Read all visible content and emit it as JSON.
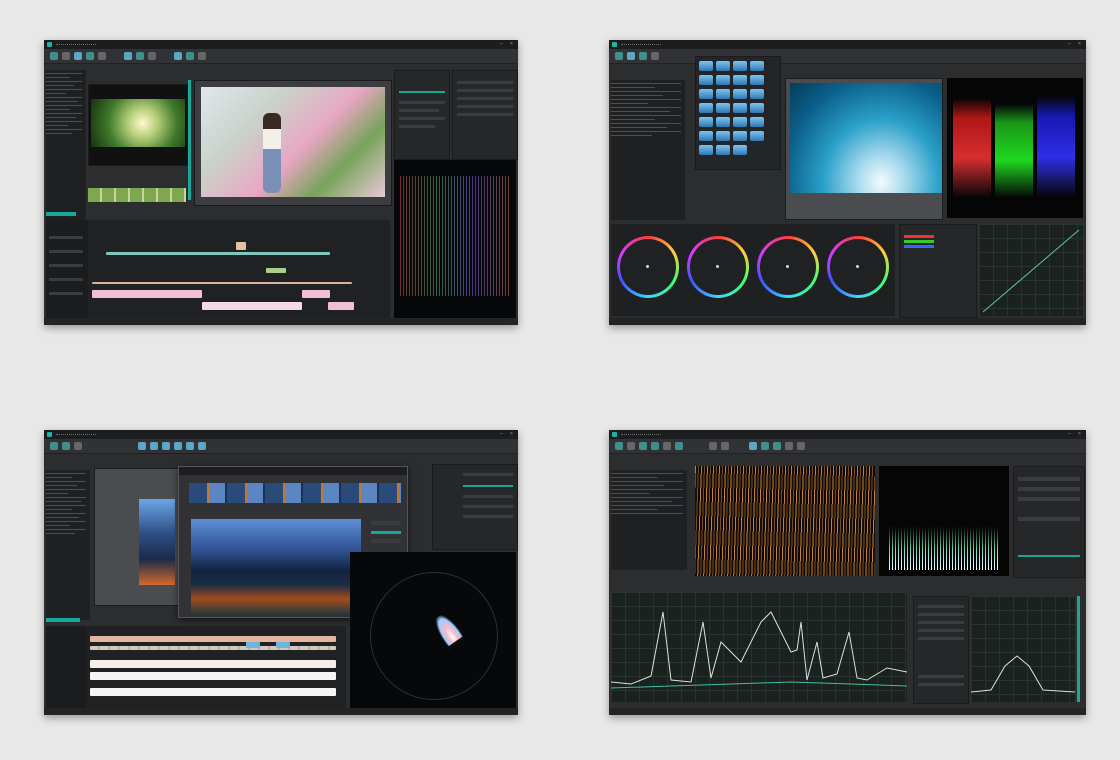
{
  "screenshots": [
    {
      "name": "timeline-editor-view"
    },
    {
      "name": "color-correction-view"
    },
    {
      "name": "motion-tracking-view"
    },
    {
      "name": "audio-waveform-view"
    }
  ],
  "colors": {
    "page_background": "#e8e8e8",
    "window_background": "#2b2d2f",
    "accent_teal": "#18a89a"
  }
}
